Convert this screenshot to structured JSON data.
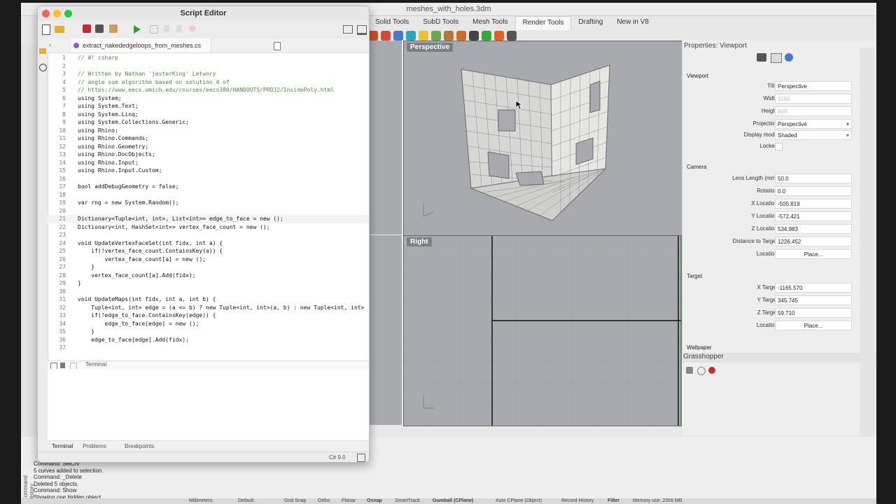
{
  "rhino": {
    "title": "meshes_with_holes.3dm",
    "tabs": [
      "Solid Tools",
      "SubD Tools",
      "Mesh Tools",
      "Render Tools",
      "Drafting",
      "New in V8"
    ],
    "active_tab": "Render Tools",
    "viewports": {
      "top": "Perspective",
      "bottom": "Right"
    },
    "command_history_label": "Command History",
    "command_history": [
      "Command: SelCrv",
      "5 curves added to selection.",
      "Command: _Delete",
      "Deleted 5 objects.",
      "Command: Show",
      "Showing one hidden object."
    ],
    "status_items": [
      "Millimeters",
      "Default",
      "Grid Snap",
      "Ortho",
      "Planar",
      "Osnap",
      "SmartTrack",
      "Gumball (CPlane)",
      "Auto CPlane (Object)",
      "Record History",
      "Filter",
      "Memory use: 2356 MB"
    ]
  },
  "properties": {
    "panel_title": "Properties: Viewport",
    "viewport_section": "Viewport",
    "title_label": "Title",
    "title_value": "Perspective",
    "width_label": "Width",
    "width_value": "1166",
    "height_label": "Height",
    "height_value": "809",
    "projection_label": "Projection",
    "projection_value": "Perspective",
    "display_mode_label": "Display mode",
    "display_mode_value": "Shaded",
    "locked_label": "Locked",
    "camera_section": "Camera",
    "lens_label": "Lens Length (mm)",
    "lens_value": "50.0",
    "rotation_label": "Rotation",
    "rotation_value": "0.0",
    "xloc_label": "X Location",
    "xloc_value": "-505.819",
    "yloc_label": "Y Location",
    "yloc_value": "-572.421",
    "zloc_label": "Z Location",
    "zloc_value": "534.983",
    "dist_label": "Distance to Target",
    "dist_value": "1226.452",
    "location_label": "Location",
    "place_label": "Place...",
    "target_section": "Target",
    "xtgt_label": "X Target",
    "xtgt_value": "-1165.570",
    "ytgt_label": "Y Target",
    "ytgt_value": "345.745",
    "ztgt_label": "Z Target",
    "ztgt_value": "59.710",
    "target_location_label": "Location",
    "target_place_label": "Place...",
    "wallpaper_section": "Wallpaper",
    "grasshopper_title": "Grasshopper"
  },
  "editor": {
    "title": "Script Editor",
    "tab_label": "extract_nakededgeloops_from_meshes.cs",
    "terminal_label": "Terminal",
    "bottom_tabs": [
      "Terminal",
      "Problems",
      "Breakpoints"
    ],
    "language": "C# 9.0",
    "code_lines": [
      {
        "n": "1",
        "text": "// #! csharp",
        "cls": "cm"
      },
      {
        "n": "2",
        "text": "",
        "cls": "cd"
      },
      {
        "n": "3",
        "text": "// Written by Nathan 'jesterKing' Letwory",
        "cls": "cm"
      },
      {
        "n": "4",
        "text": "// angle sum algorithm based on solution 4 of",
        "cls": "cm"
      },
      {
        "n": "5",
        "text": "// https://www.eecs.umich.edu/courses/eecs380/HANDOUTS/PROJ2/InsidePoly.html",
        "cls": "cm"
      },
      {
        "n": "6",
        "text": "using System;",
        "cls": "cd"
      },
      {
        "n": "7",
        "text": "using System.Text;",
        "cls": "cd"
      },
      {
        "n": "8",
        "text": "using System.Linq;",
        "cls": "cd"
      },
      {
        "n": "9",
        "text": "using System.Collections.Generic;",
        "cls": "cd"
      },
      {
        "n": "10",
        "text": "using Rhino;",
        "cls": "cd"
      },
      {
        "n": "11",
        "text": "using Rhino.Commands;",
        "cls": "cd"
      },
      {
        "n": "12",
        "text": "using Rhino.Geometry;",
        "cls": "cd"
      },
      {
        "n": "13",
        "text": "using Rhino.DocObjects;",
        "cls": "cd"
      },
      {
        "n": "14",
        "text": "using Rhino.Input;",
        "cls": "cd"
      },
      {
        "n": "15",
        "text": "using Rhino.Input.Custom;",
        "cls": "cd"
      },
      {
        "n": "16",
        "text": "",
        "cls": "cd"
      },
      {
        "n": "17",
        "text": "bool addDebugGeometry = false;",
        "cls": "cd"
      },
      {
        "n": "18",
        "text": "",
        "cls": "cd"
      },
      {
        "n": "19",
        "text": "var rng = new System.Random();",
        "cls": "cd"
      },
      {
        "n": "20",
        "text": "",
        "cls": "cd"
      },
      {
        "n": "21",
        "text": "Dictionary<Tuple<int, int>, List<int>> edge_to_face = new ();",
        "cls": "cd hl"
      },
      {
        "n": "22",
        "text": "Dictionary<int, HashSet<int>> vertex_face_count = new ();",
        "cls": "cd"
      },
      {
        "n": "23",
        "text": "",
        "cls": "cd"
      },
      {
        "n": "24",
        "text": "void UpdateVertexFaceSet(int fidx, int a) {",
        "cls": "cd"
      },
      {
        "n": "25",
        "text": "    if(!vertex_face_count.ContainsKey(a)) {",
        "cls": "cd"
      },
      {
        "n": "26",
        "text": "        vertex_face_count[a] = new ();",
        "cls": "cd"
      },
      {
        "n": "27",
        "text": "    }",
        "cls": "cd"
      },
      {
        "n": "28",
        "text": "    vertex_face_count[a].Add(fidx);",
        "cls": "cd"
      },
      {
        "n": "29",
        "text": "}",
        "cls": "cd"
      },
      {
        "n": "30",
        "text": "",
        "cls": "cd"
      },
      {
        "n": "31",
        "text": "void UpdateMaps(int fidx, int a, int b) {",
        "cls": "cd"
      },
      {
        "n": "32",
        "text": "    Tuple<int, int> edge = (a <= b) ? new Tuple<int, int>(a, b) : new Tuple<int, int>",
        "cls": "cd"
      },
      {
        "n": "33",
        "text": "    if(!edge_to_face.ContainsKey(edge)) {",
        "cls": "cd"
      },
      {
        "n": "34",
        "text": "        edge_to_face[edge] = new ();",
        "cls": "cd"
      },
      {
        "n": "35",
        "text": "    }",
        "cls": "cd"
      },
      {
        "n": "36",
        "text": "    edge_to_face[edge].Add(fidx);",
        "cls": "cd"
      },
      {
        "n": "37",
        "text": "",
        "cls": "cd"
      }
    ]
  },
  "colors": {
    "viewport_bg": "#a8aaaf",
    "comment": "#4a8a3a",
    "close": "#fe5f57",
    "minimize": "#febc2e",
    "maximize": "#28c840"
  }
}
